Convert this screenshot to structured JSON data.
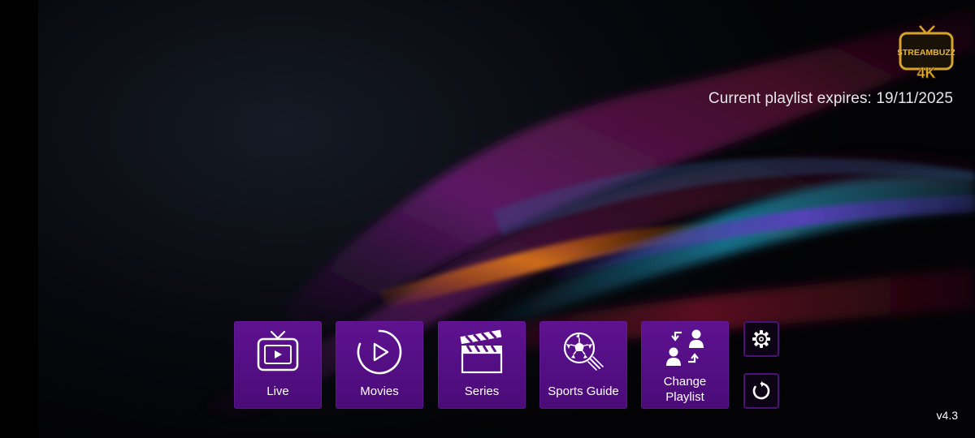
{
  "app": {
    "logo_text_top": "STREAMBUZZ",
    "logo_text_bottom": "4K",
    "expiry_text": "Current playlist expires: 19/11/2025",
    "version": "v4.3"
  },
  "menu": {
    "tiles": [
      {
        "label": "Live",
        "icon": "tv-play-icon"
      },
      {
        "label": "Movies",
        "icon": "play-circle-icon"
      },
      {
        "label": "Series",
        "icon": "clapperboard-icon"
      },
      {
        "label": "Sports Guide",
        "icon": "soccer-ball-icon"
      },
      {
        "label": "Change\nPlaylist",
        "icon": "switch-users-icon"
      }
    ],
    "side_buttons": [
      {
        "icon": "gear-icon"
      },
      {
        "icon": "refresh-icon"
      }
    ]
  },
  "colors": {
    "tile": "#5a1089",
    "tile_border": "#4b1174",
    "logo_gold": "#d6a42b",
    "background": "#05060a"
  }
}
